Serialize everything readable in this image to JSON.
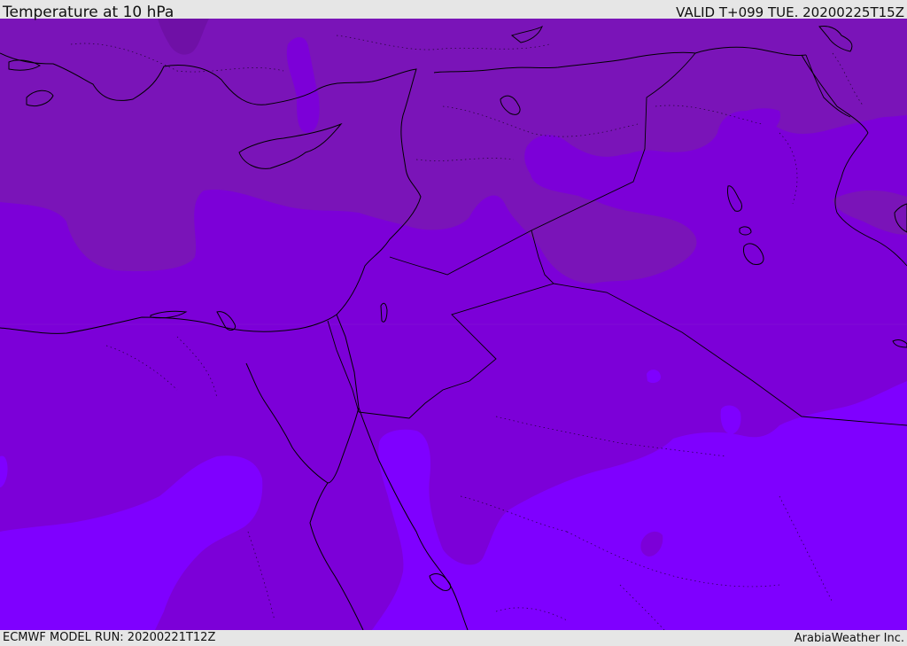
{
  "header": {
    "title": "Temperature at 10 hPa",
    "valid": "VALID T+099 TUE. 20200225T15Z"
  },
  "footer": {
    "model_run": "ECMWF MODEL RUN: 20200221T12Z",
    "credit": "ArabiaWeather Inc."
  },
  "colors": {
    "band_cold": "#7a14b8",
    "band_mid": "#7c00d8",
    "band_warm": "#7f00ff",
    "band_coldest": "#6f10a6",
    "coast": "#000000",
    "border": "#000000",
    "frame": "#e6e6e6"
  }
}
